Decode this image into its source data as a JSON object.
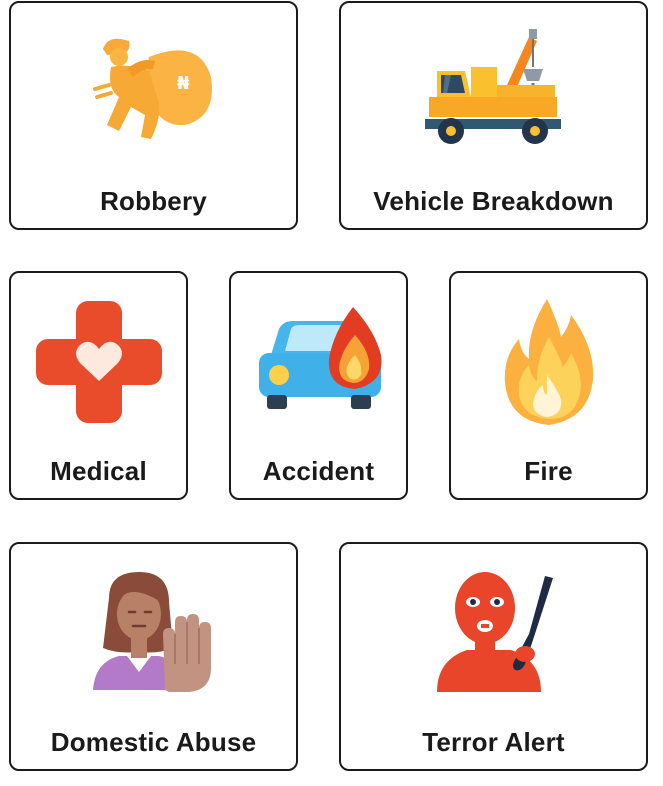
{
  "categories": [
    {
      "id": "robbery",
      "label": "Robbery",
      "icon": "robbery-thief-icon"
    },
    {
      "id": "vehicle-breakdown",
      "label": "Vehicle Breakdown",
      "icon": "tow-truck-icon"
    },
    {
      "id": "medical",
      "label": "Medical",
      "icon": "medical-cross-icon"
    },
    {
      "id": "accident",
      "label": "Accident",
      "icon": "car-fire-icon"
    },
    {
      "id": "fire",
      "label": "Fire",
      "icon": "flame-icon"
    },
    {
      "id": "domestic-abuse",
      "label": "Domestic Abuse",
      "icon": "woman-stop-hand-icon"
    },
    {
      "id": "terror-alert",
      "label": "Terror Alert",
      "icon": "masked-terrorist-icon"
    }
  ],
  "colors": {
    "border": "#1b1b1b",
    "robbery": "#f9b544",
    "medical": "#e84c2b",
    "accident_car": "#3fb1e8",
    "fire": "#fbb040",
    "terror": "#e8452a"
  }
}
